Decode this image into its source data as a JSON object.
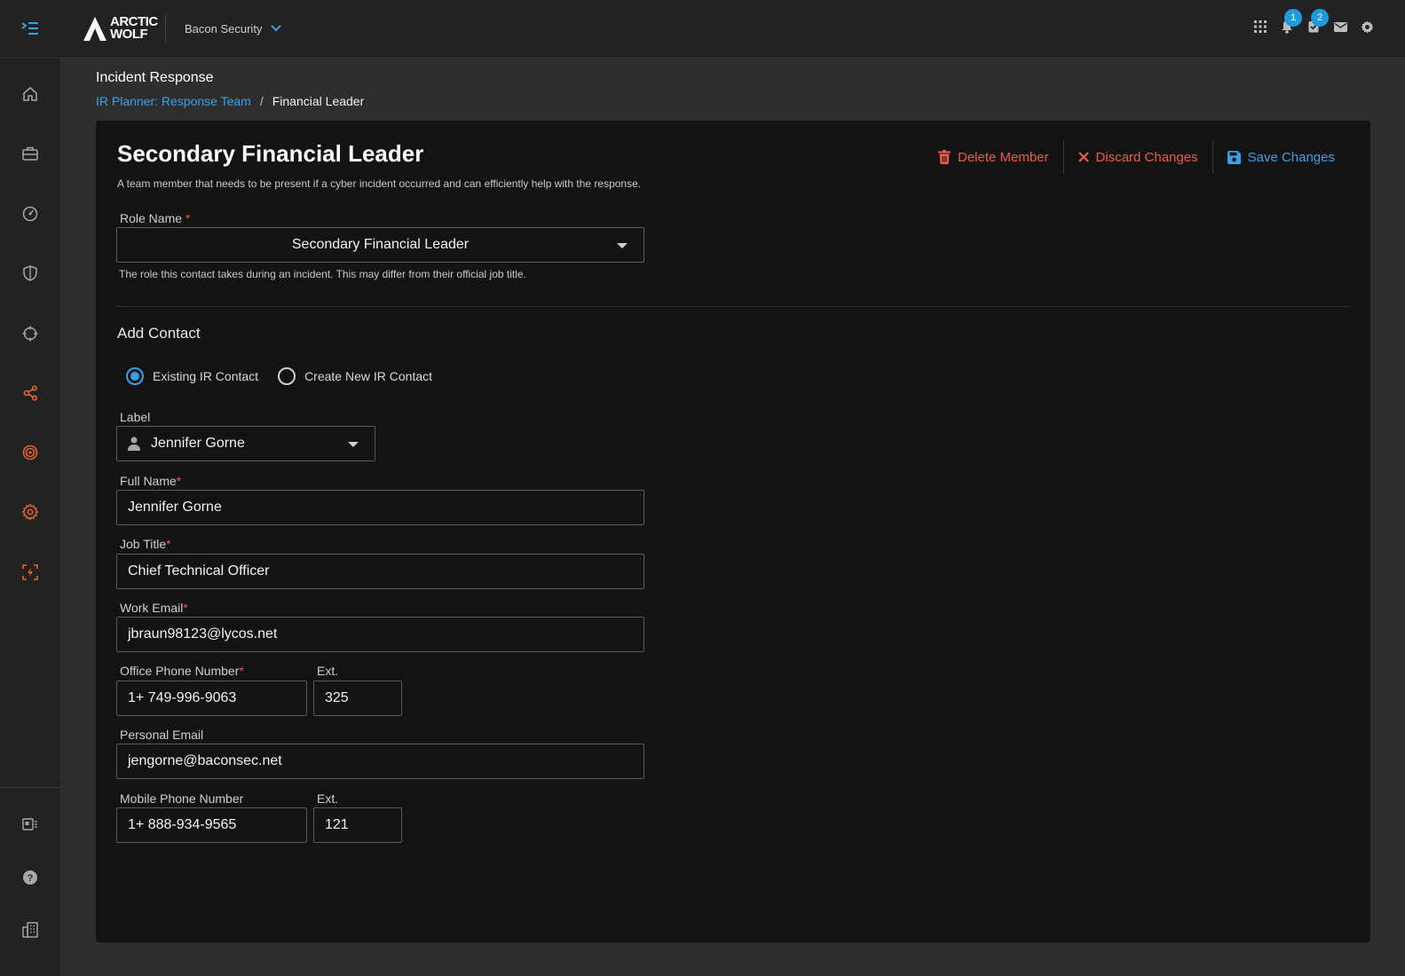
{
  "header": {
    "logo_line1": "ARCTIC",
    "logo_line2": "WOLF",
    "org_name": "Bacon Security",
    "notifications_count": "1",
    "tasks_count": "2"
  },
  "page": {
    "title": "Incident Response",
    "breadcrumb_link": "IR Planner: Response Team",
    "breadcrumb_sep": "/",
    "breadcrumb_current": "Financial Leader"
  },
  "card": {
    "title": "Secondary Financial Leader",
    "description": "A team member that needs to be present if a cyber incident occurred and can efficiently help with the response.",
    "actions": {
      "delete": "Delete Member",
      "discard": "Discard Changes",
      "save": "Save Changes"
    }
  },
  "role": {
    "label": "Role Name",
    "required": "*",
    "value": "Secondary Financial Leader",
    "helper": "The role this contact takes during an incident. This may differ from their official job title."
  },
  "contact": {
    "section_title": "Add Contact",
    "radio_existing": "Existing IR Contact",
    "radio_new": "Create New IR Contact",
    "selected_option": "Existing IR Contact",
    "label_label": "Label",
    "label_value": "Jennifer Gorne",
    "full_name_label": "Full Name",
    "full_name_value": "Jennifer Gorne",
    "job_title_label": "Job Title",
    "job_title_value": "Chief Technical Officer",
    "work_email_label": "Work Email",
    "work_email_value": "jbraun98123@lycos.net",
    "office_phone_label": "Office Phone Number",
    "office_phone_value": "1+ 749-996-9063",
    "office_ext_label": "Ext.",
    "office_ext_value": "325",
    "personal_email_label": "Personal Email",
    "personal_email_value": "jengorne@baconsec.net",
    "mobile_phone_label": "Mobile Phone Number",
    "mobile_phone_value": "1+ 888-934-9565",
    "mobile_ext_label": "Ext.",
    "mobile_ext_value": "121"
  },
  "colors": {
    "accent_blue": "#3aa0e6",
    "danger_red": "#f05a4a",
    "nav_orange": "#e8652e",
    "badge_blue": "#1e9bdc"
  },
  "icons": {
    "sidebar": [
      "home-icon",
      "briefcase-icon",
      "gauge-icon",
      "shield-icon",
      "crosshair-icon",
      "network-icon",
      "radar-icon",
      "gear-icon",
      "incident-icon",
      "id-card-icon",
      "help-icon",
      "building-icon"
    ],
    "header": [
      "menu-toggle-icon",
      "apps-grid-icon",
      "bell-icon",
      "tasks-icon",
      "mail-icon",
      "settings-icon"
    ]
  }
}
